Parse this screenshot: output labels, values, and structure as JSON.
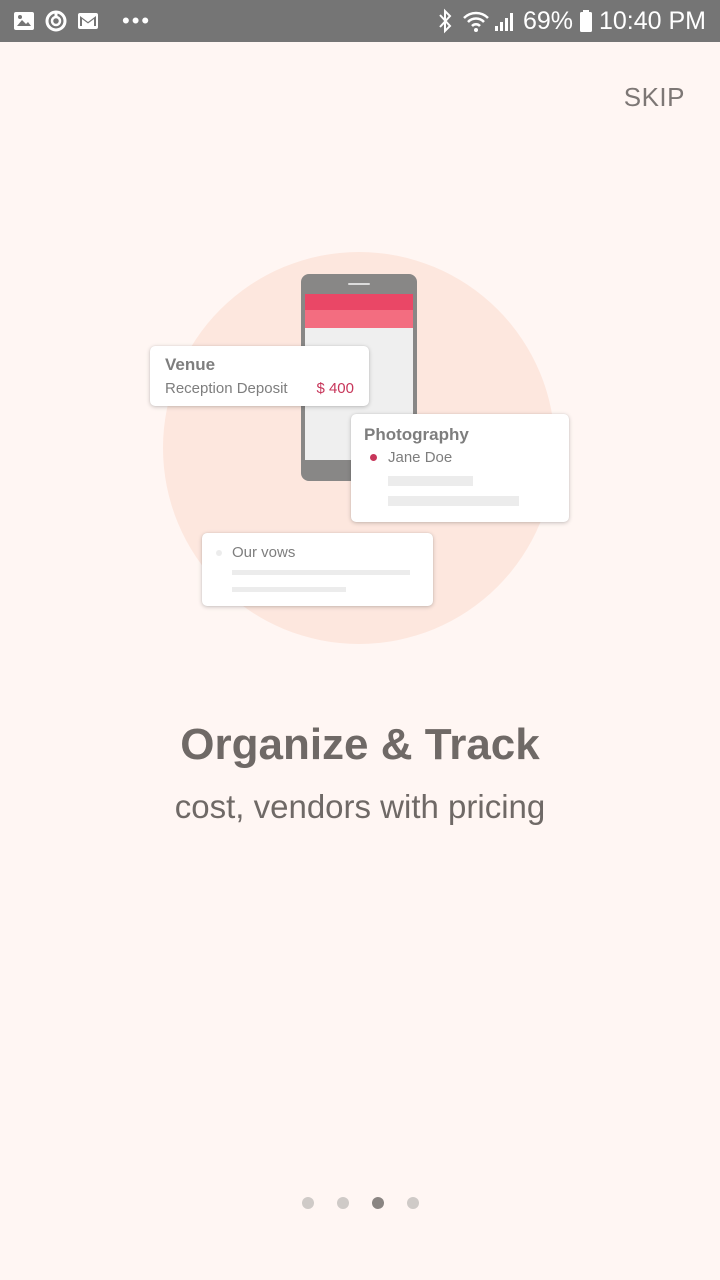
{
  "status_bar": {
    "left_icons": [
      "image-icon",
      "sync-icon",
      "gmail-icon"
    ],
    "overflow": "•••",
    "right_icons": [
      "bluetooth-icon",
      "wifi-icon",
      "signal-icon",
      "battery-icon"
    ],
    "battery": "69%",
    "time": "10:40 PM"
  },
  "skip_label": "SKIP",
  "illustration": {
    "venue_card": {
      "title": "Venue",
      "item": "Reception Deposit",
      "amount": "$ 400"
    },
    "photo_card": {
      "title": "Photography",
      "name": "Jane Doe"
    },
    "vows_card": {
      "title": "Our vows"
    }
  },
  "headline": "Organize & Track",
  "subline": "cost, vendors with pricing",
  "pager": {
    "count": 4,
    "active_index": 2
  },
  "colors": {
    "background": "#fff6f3",
    "accent": "#ea4766",
    "amount": "#c7365a",
    "text": "#6f6966",
    "status_bar": "#757575"
  }
}
